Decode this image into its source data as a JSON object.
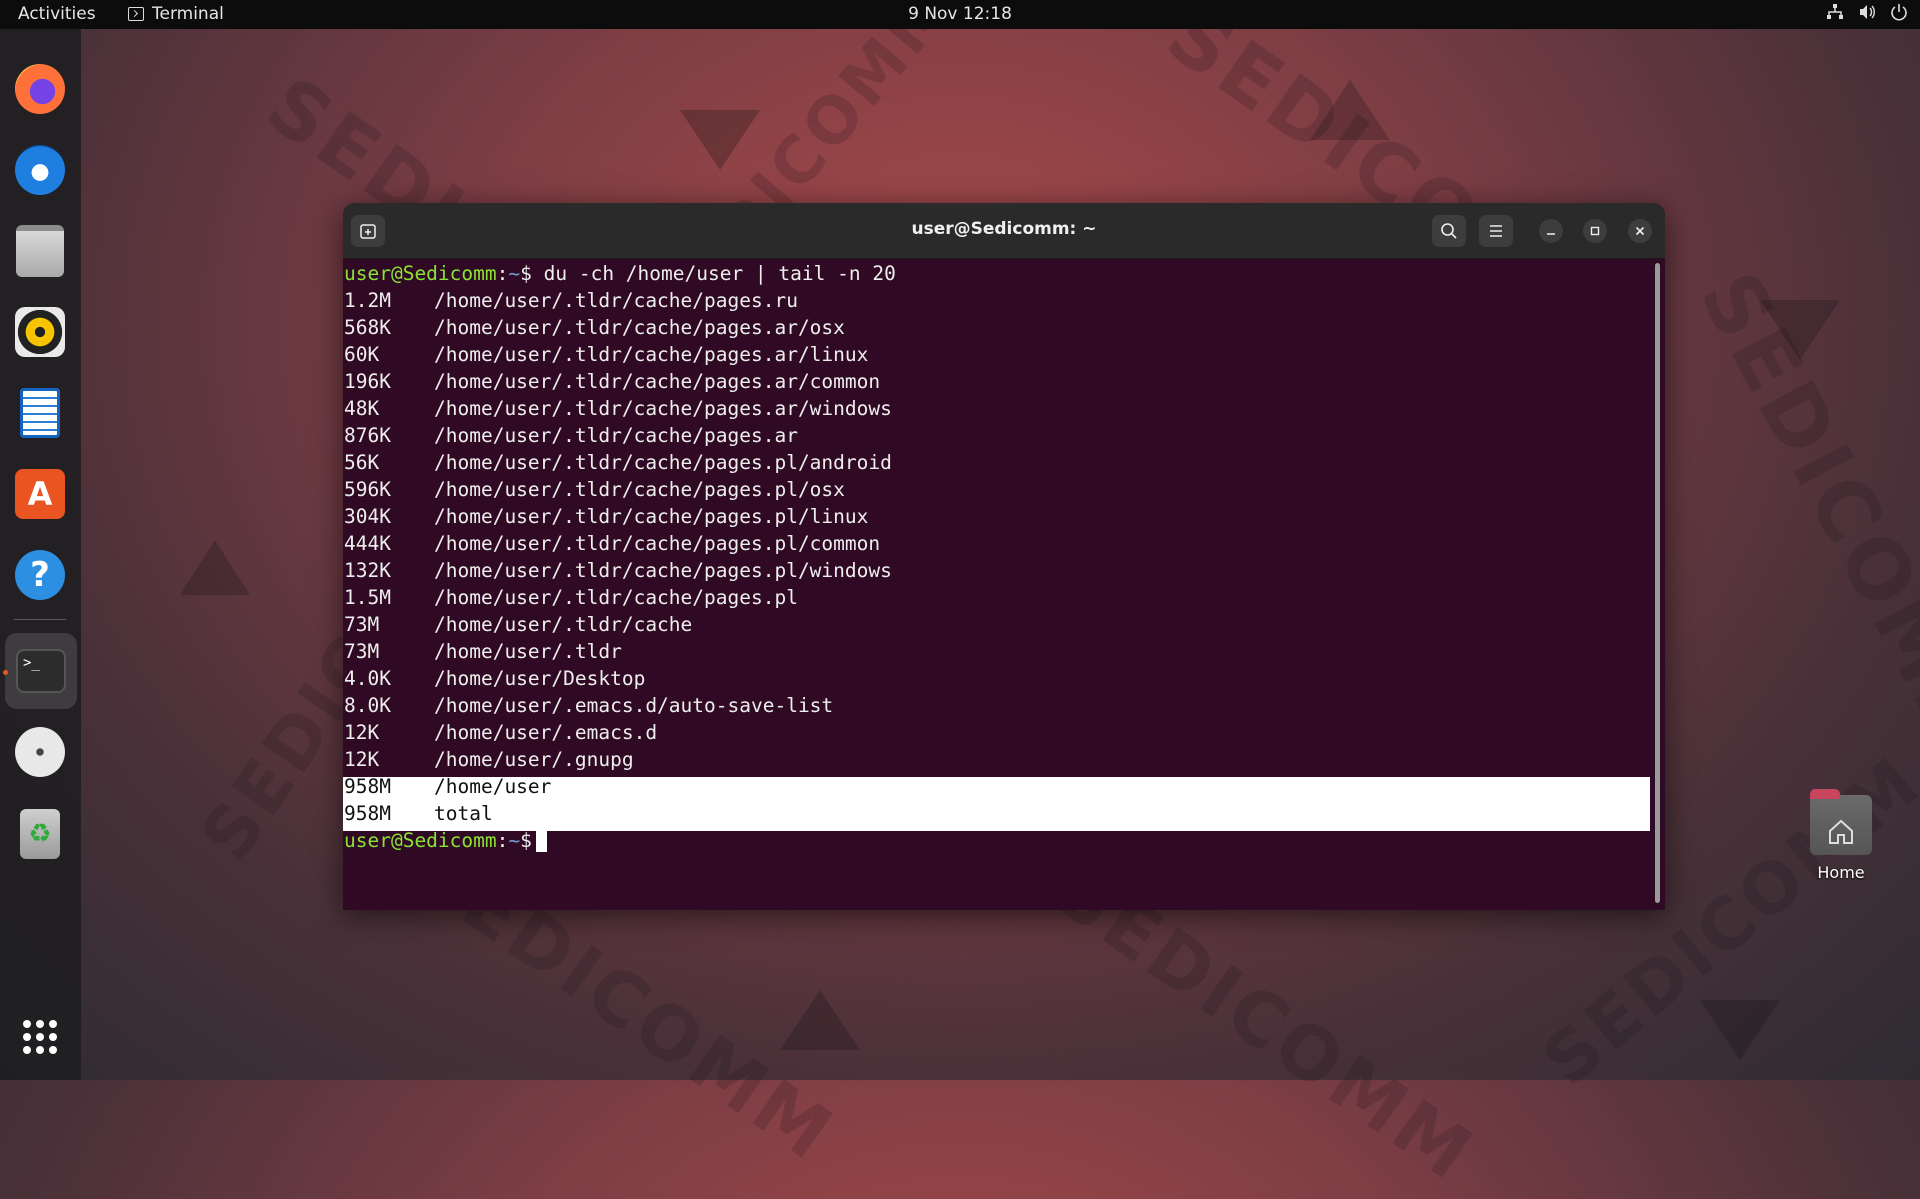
{
  "topbar": {
    "activities": "Activities",
    "app_name": "Terminal",
    "clock": "9 Nov  12:18"
  },
  "wallpaper": {
    "watermark": "SEDICOMM"
  },
  "dock": {
    "items": [
      {
        "icon": "firefox-icon",
        "name": "Firefox"
      },
      {
        "icon": "thunderbird-icon",
        "name": "Thunderbird"
      },
      {
        "icon": "files-icon",
        "name": "Files"
      },
      {
        "icon": "rhythmbox-icon",
        "name": "Rhythmbox"
      },
      {
        "icon": "libreoffice-writer-icon",
        "name": "LibreOffice Writer"
      },
      {
        "icon": "software-center-icon",
        "name": "Ubuntu Software"
      },
      {
        "icon": "help-icon",
        "name": "Help"
      },
      {
        "icon": "terminal-icon",
        "name": "Terminal",
        "active": true
      },
      {
        "icon": "optical-disc-icon",
        "name": "Disc"
      },
      {
        "icon": "trash-icon",
        "name": "Trash"
      },
      {
        "icon": "app-grid-icon",
        "name": "Show Applications"
      }
    ],
    "accent": "#e95420"
  },
  "terminal": {
    "title": "user@Sedicomm: ~",
    "prompt_user": "user@Sedicomm",
    "prompt_sep": ":",
    "prompt_path": "~",
    "prompt_symbol": "$",
    "command": " du -ch /home/user | tail -n 20",
    "output": [
      {
        "size": "1.2M",
        "path": "/home/user/.tldr/cache/pages.ru"
      },
      {
        "size": "568K",
        "path": "/home/user/.tldr/cache/pages.ar/osx"
      },
      {
        "size": "60K",
        "path": "/home/user/.tldr/cache/pages.ar/linux"
      },
      {
        "size": "196K",
        "path": "/home/user/.tldr/cache/pages.ar/common"
      },
      {
        "size": "48K",
        "path": "/home/user/.tldr/cache/pages.ar/windows"
      },
      {
        "size": "876K",
        "path": "/home/user/.tldr/cache/pages.ar"
      },
      {
        "size": "56K",
        "path": "/home/user/.tldr/cache/pages.pl/android"
      },
      {
        "size": "596K",
        "path": "/home/user/.tldr/cache/pages.pl/osx"
      },
      {
        "size": "304K",
        "path": "/home/user/.tldr/cache/pages.pl/linux"
      },
      {
        "size": "444K",
        "path": "/home/user/.tldr/cache/pages.pl/common"
      },
      {
        "size": "132K",
        "path": "/home/user/.tldr/cache/pages.pl/windows"
      },
      {
        "size": "1.5M",
        "path": "/home/user/.tldr/cache/pages.pl"
      },
      {
        "size": "73M",
        "path": "/home/user/.tldr/cache"
      },
      {
        "size": "73M",
        "path": "/home/user/.tldr"
      },
      {
        "size": "4.0K",
        "path": "/home/user/Desktop"
      },
      {
        "size": "8.0K",
        "path": "/home/user/.emacs.d/auto-save-list"
      },
      {
        "size": "12K",
        "path": "/home/user/.emacs.d"
      },
      {
        "size": "12K",
        "path": "/home/user/.gnupg"
      },
      {
        "size": "958M",
        "path": "/home/user"
      },
      {
        "size": "958M",
        "path": "total"
      }
    ],
    "colors": {
      "background": "#300a24",
      "prompt_user": "#8ae234",
      "prompt_path": "#729fcf",
      "text": "#eeeeec"
    }
  },
  "desktop": {
    "home_label": "Home"
  }
}
